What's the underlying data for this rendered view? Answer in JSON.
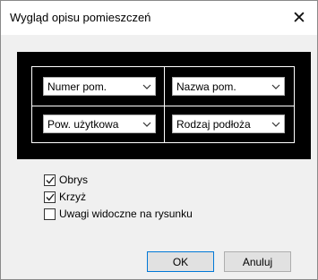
{
  "dialog": {
    "title": "Wygląd opisu pomieszczeń"
  },
  "preview": {
    "fields": [
      {
        "value": "Numer pom."
      },
      {
        "value": "Nazwa pom."
      },
      {
        "value": "Pow. użytkowa"
      },
      {
        "value": "Rodzaj podłoża"
      }
    ]
  },
  "options": [
    {
      "label": "Obrys",
      "checked": true
    },
    {
      "label": "Krzyż",
      "checked": true
    },
    {
      "label": "Uwagi widoczne na rysunku",
      "checked": false
    }
  ],
  "buttons": {
    "ok_label": "OK",
    "cancel_label": "Anuluj"
  }
}
